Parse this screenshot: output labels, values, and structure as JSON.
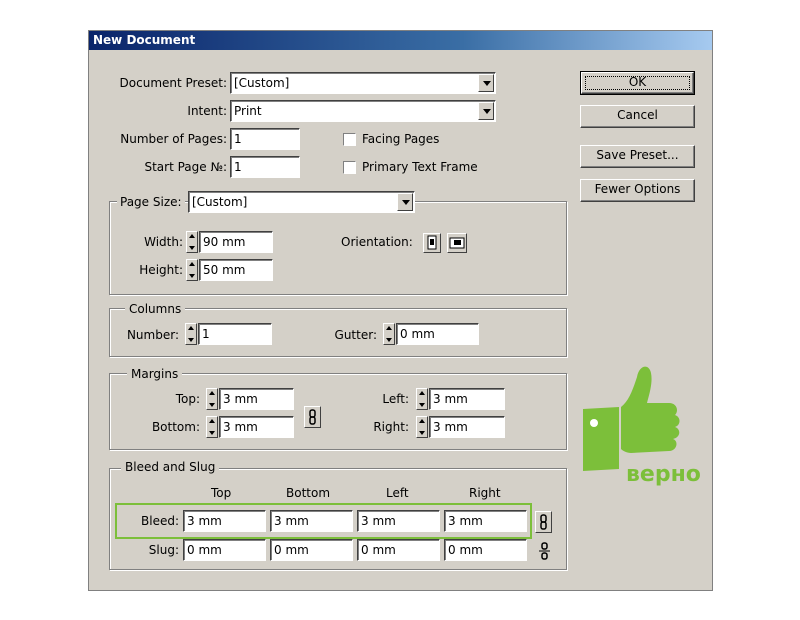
{
  "dialog": {
    "title": "New Document",
    "buttons": {
      "ok": "OK",
      "cancel": "Cancel",
      "save_preset": "Save Preset...",
      "fewer_options": "Fewer Options"
    },
    "document_preset": {
      "label": "Document Preset:",
      "value": "[Custom]"
    },
    "intent": {
      "label": "Intent:",
      "value": "Print"
    },
    "number_of_pages": {
      "label": "Number of Pages:",
      "value": "1"
    },
    "start_page": {
      "label": "Start Page №:",
      "value": "1"
    },
    "facing_pages": {
      "label": "Facing Pages",
      "checked": false
    },
    "primary_text_frame": {
      "label": "Primary Text Frame",
      "checked": false
    },
    "page_size": {
      "label": "Page Size:",
      "value": "[Custom]",
      "width": {
        "label": "Width:",
        "value": "90 mm"
      },
      "height": {
        "label": "Height:",
        "value": "50 mm"
      },
      "orientation_label": "Orientation:"
    },
    "columns": {
      "title": "Columns",
      "number": {
        "label": "Number:",
        "value": "1"
      },
      "gutter": {
        "label": "Gutter:",
        "value": "0 mm"
      }
    },
    "margins": {
      "title": "Margins",
      "top": {
        "label": "Top:",
        "value": "3 mm"
      },
      "bottom": {
        "label": "Bottom:",
        "value": "3 mm"
      },
      "left": {
        "label": "Left:",
        "value": "3 mm"
      },
      "right": {
        "label": "Right:",
        "value": "3 mm"
      }
    },
    "bleed_slug": {
      "title": "Bleed and Slug",
      "headers": [
        "Top",
        "Bottom",
        "Left",
        "Right"
      ],
      "bleed": {
        "label": "Bleed:",
        "values": [
          "3 mm",
          "3 mm",
          "3 mm",
          "3 mm"
        ]
      },
      "slug": {
        "label": "Slug:",
        "values": [
          "0 mm",
          "0 mm",
          "0 mm",
          "0 mm"
        ]
      }
    }
  },
  "overlay": {
    "caption": "верно",
    "accent_color": "#7cbf3a",
    "icon": "thumbs-up-icon"
  }
}
